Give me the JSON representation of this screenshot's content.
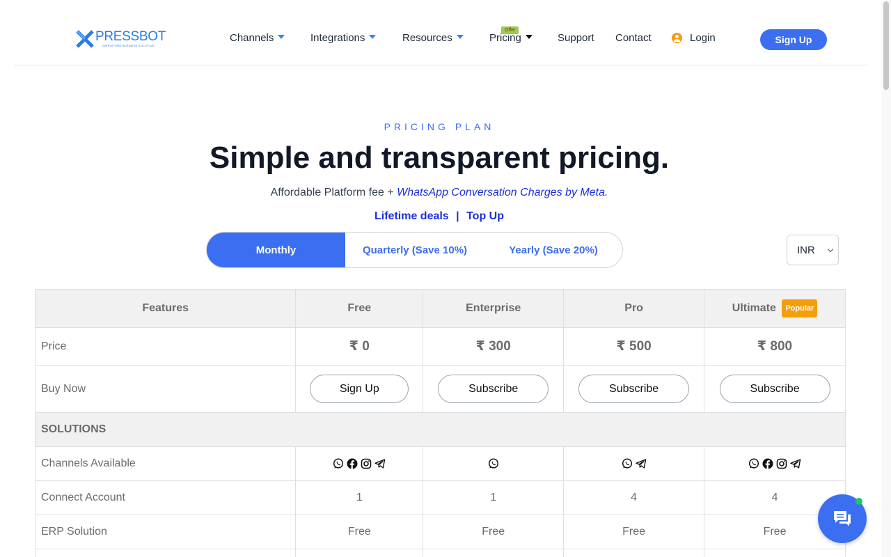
{
  "brand": {
    "name": "PRESSBOT",
    "tagline": "SIMPLIFYING BUSINESS SOLUTION",
    "color": "#2a7de1"
  },
  "nav": {
    "channels": "Channels",
    "integrations": "Integrations",
    "resources": "Resources",
    "pricing": "Pricing",
    "pricing_badge": "Offer",
    "support": "Support",
    "contact": "Contact",
    "login": "Login",
    "signup": "Sign Up"
  },
  "hero": {
    "eyebrow": "PRICING PLAN",
    "title": "Simple and transparent pricing.",
    "subtitle_prefix": "Affordable Platform fee  + ",
    "subtitle_link": "WhatsApp Conversation Charges by Meta.",
    "lifetime": "Lifetime deals",
    "separator": "|",
    "topup": "Top Up"
  },
  "billing": {
    "monthly": "Monthly",
    "quarterly": "Quarterly (Save 10%)",
    "yearly": "Yearly (Save 20%)",
    "selected": "Monthly"
  },
  "currency": {
    "selected": "INR"
  },
  "table": {
    "headers": [
      "Features",
      "Free",
      "Enterprise",
      "Pro",
      "Ultimate"
    ],
    "popular_badge": "Popular",
    "price_label": "Price",
    "prices": [
      "₹ 0",
      "₹ 300",
      "₹ 500",
      "₹ 800"
    ],
    "buy_label": "Buy Now",
    "buy_buttons": [
      "Sign Up",
      "Subscribe",
      "Subscribe",
      "Subscribe"
    ],
    "section": "SOLUTIONS",
    "channels_label": "Channels Available",
    "channels": [
      [
        "whatsapp-icon",
        "facebook-icon",
        "instagram-icon",
        "telegram-icon"
      ],
      [
        "whatsapp-icon"
      ],
      [
        "whatsapp-icon",
        "telegram-icon"
      ],
      [
        "whatsapp-icon",
        "facebook-icon",
        "instagram-icon",
        "telegram-icon"
      ]
    ],
    "connect_label": "Connect Account",
    "connect": [
      "1",
      "1",
      "4",
      "4"
    ],
    "erp_label": "ERP Solution",
    "erp": [
      "Free",
      "Free",
      "Free",
      "Free"
    ]
  },
  "colors": {
    "accent": "#3b6ef0",
    "link": "#1a2fdc",
    "popular": "#f59e0b",
    "offer": "#9ccb54",
    "online": "#22c55e"
  },
  "chat_icon": "chat-icon"
}
